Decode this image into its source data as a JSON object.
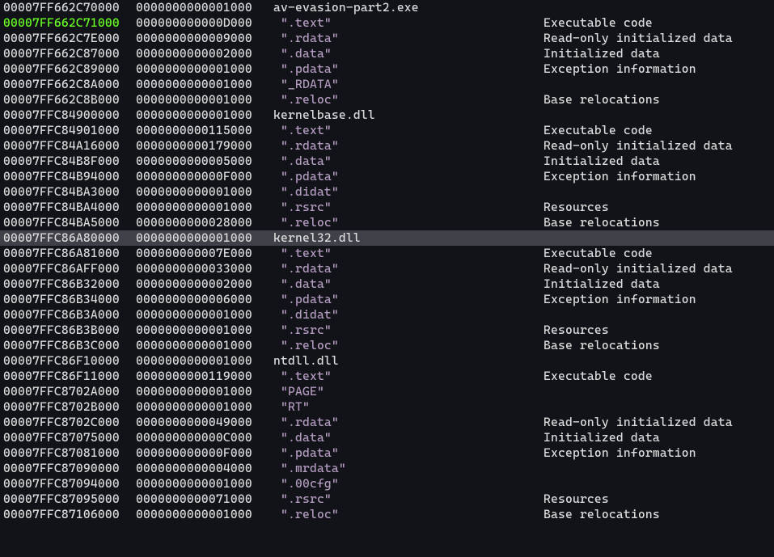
{
  "rows": [
    {
      "addr": "00007FF662C70000",
      "size": "0000000000001000",
      "name": "av-evasion-part2.exe",
      "info": "",
      "isSection": false
    },
    {
      "addr": "00007FF662C71000",
      "size": "000000000000D000",
      "name": "\".text\"",
      "info": "Executable code",
      "isSection": true,
      "active": true
    },
    {
      "addr": "00007FF662C7E000",
      "size": "0000000000009000",
      "name": "\".rdata\"",
      "info": "Read-only initialized data",
      "isSection": true
    },
    {
      "addr": "00007FF662C87000",
      "size": "0000000000002000",
      "name": "\".data\"",
      "info": "Initialized data",
      "isSection": true
    },
    {
      "addr": "00007FF662C89000",
      "size": "0000000000001000",
      "name": "\".pdata\"",
      "info": "Exception information",
      "isSection": true
    },
    {
      "addr": "00007FF662C8A000",
      "size": "0000000000001000",
      "name": "\"_RDATA\"",
      "info": "",
      "isSection": true
    },
    {
      "addr": "00007FF662C8B000",
      "size": "0000000000001000",
      "name": "\".reloc\"",
      "info": "Base relocations",
      "isSection": true
    },
    {
      "addr": "00007FFC84900000",
      "size": "0000000000001000",
      "name": "kernelbase.dll",
      "info": "",
      "isSection": false
    },
    {
      "addr": "00007FFC84901000",
      "size": "0000000000115000",
      "name": "\".text\"",
      "info": "Executable code",
      "isSection": true
    },
    {
      "addr": "00007FFC84A16000",
      "size": "0000000000179000",
      "name": "\".rdata\"",
      "info": "Read-only initialized data",
      "isSection": true
    },
    {
      "addr": "00007FFC84B8F000",
      "size": "0000000000005000",
      "name": "\".data\"",
      "info": "Initialized data",
      "isSection": true
    },
    {
      "addr": "00007FFC84B94000",
      "size": "000000000000F000",
      "name": "\".pdata\"",
      "info": "Exception information",
      "isSection": true
    },
    {
      "addr": "00007FFC84BA3000",
      "size": "0000000000001000",
      "name": "\".didat\"",
      "info": "",
      "isSection": true
    },
    {
      "addr": "00007FFC84BA4000",
      "size": "0000000000001000",
      "name": "\".rsrc\"",
      "info": "Resources",
      "isSection": true
    },
    {
      "addr": "00007FFC84BA5000",
      "size": "0000000000028000",
      "name": "\".reloc\"",
      "info": "Base relocations",
      "isSection": true
    },
    {
      "addr": "00007FFC86A80000",
      "size": "0000000000001000",
      "name": "kernel32.dll",
      "info": "",
      "isSection": false,
      "selected": true
    },
    {
      "addr": "00007FFC86A81000",
      "size": "000000000007E000",
      "name": "\".text\"",
      "info": "Executable code",
      "isSection": true
    },
    {
      "addr": "00007FFC86AFF000",
      "size": "0000000000033000",
      "name": "\".rdata\"",
      "info": "Read-only initialized data",
      "isSection": true
    },
    {
      "addr": "00007FFC86B32000",
      "size": "0000000000002000",
      "name": "\".data\"",
      "info": "Initialized data",
      "isSection": true
    },
    {
      "addr": "00007FFC86B34000",
      "size": "0000000000006000",
      "name": "\".pdata\"",
      "info": "Exception information",
      "isSection": true
    },
    {
      "addr": "00007FFC86B3A000",
      "size": "0000000000001000",
      "name": "\".didat\"",
      "info": "",
      "isSection": true
    },
    {
      "addr": "00007FFC86B3B000",
      "size": "0000000000001000",
      "name": "\".rsrc\"",
      "info": "Resources",
      "isSection": true
    },
    {
      "addr": "00007FFC86B3C000",
      "size": "0000000000001000",
      "name": "\".reloc\"",
      "info": "Base relocations",
      "isSection": true
    },
    {
      "addr": "00007FFC86F10000",
      "size": "0000000000001000",
      "name": "ntdll.dll",
      "info": "",
      "isSection": false
    },
    {
      "addr": "00007FFC86F11000",
      "size": "0000000000119000",
      "name": "\".text\"",
      "info": "Executable code",
      "isSection": true
    },
    {
      "addr": "00007FFC8702A000",
      "size": "0000000000001000",
      "name": "\"PAGE\"",
      "info": "",
      "isSection": true
    },
    {
      "addr": "00007FFC8702B000",
      "size": "0000000000001000",
      "name": "\"RT\"",
      "info": "",
      "isSection": true
    },
    {
      "addr": "00007FFC8702C000",
      "size": "0000000000049000",
      "name": "\".rdata\"",
      "info": "Read-only initialized data",
      "isSection": true
    },
    {
      "addr": "00007FFC87075000",
      "size": "000000000000C000",
      "name": "\".data\"",
      "info": "Initialized data",
      "isSection": true
    },
    {
      "addr": "00007FFC87081000",
      "size": "000000000000F000",
      "name": "\".pdata\"",
      "info": "Exception information",
      "isSection": true
    },
    {
      "addr": "00007FFC87090000",
      "size": "0000000000004000",
      "name": "\".mrdata\"",
      "info": "",
      "isSection": true
    },
    {
      "addr": "00007FFC87094000",
      "size": "0000000000001000",
      "name": "\".00cfg\"",
      "info": "",
      "isSection": true
    },
    {
      "addr": "00007FFC87095000",
      "size": "0000000000071000",
      "name": "\".rsrc\"",
      "info": "Resources",
      "isSection": true
    },
    {
      "addr": "00007FFC87106000",
      "size": "0000000000001000",
      "name": "\".reloc\"",
      "info": "Base relocations",
      "isSection": true
    }
  ]
}
